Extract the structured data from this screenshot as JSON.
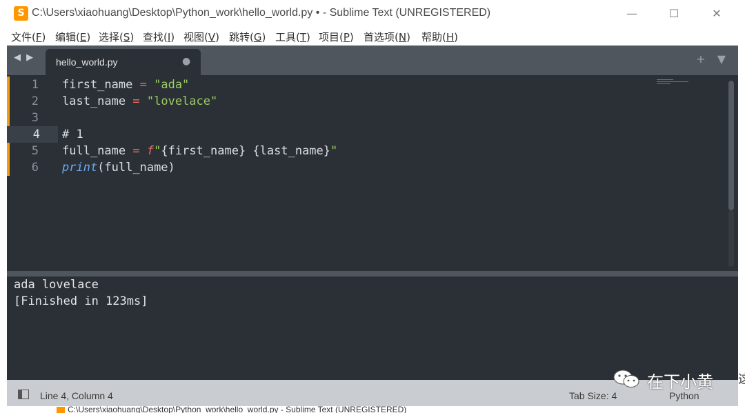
{
  "window": {
    "title": "C:\\Users\\xiaohuang\\Desktop\\Python_work\\hello_world.py • - Sublime Text (UNREGISTERED)",
    "icon": "sublime-logo-icon",
    "app_icon_glyph": "S",
    "minimize": "—",
    "maximize": "☐",
    "close": "✕"
  },
  "menu": [
    {
      "label": "文件(",
      "key": "F",
      "end": ")"
    },
    {
      "label": "编辑(",
      "key": "E",
      "end": ")"
    },
    {
      "label": "选择(",
      "key": "S",
      "end": ")"
    },
    {
      "label": "查找(",
      "key": "I",
      "end": ")"
    },
    {
      "label": "视图(",
      "key": "V",
      "end": ")"
    },
    {
      "label": "跳转(",
      "key": "G",
      "end": ")"
    },
    {
      "label": "工具(",
      "key": "T",
      "end": ")"
    },
    {
      "label": "项目(",
      "key": "P",
      "end": ")"
    },
    {
      "label": "首选项(",
      "key": "N",
      "end": ")"
    },
    {
      "label": "帮助(",
      "key": "H",
      "end": ")"
    }
  ],
  "tabs": {
    "nav": "◀ ▶",
    "active_tab": "hello_world.py",
    "dirty_indicator": "●",
    "right_controls": "+ ▼"
  },
  "editor": {
    "lines": [
      {
        "num": "1"
      },
      {
        "num": "2"
      },
      {
        "num": "3"
      },
      {
        "num": "4"
      },
      {
        "num": "5"
      },
      {
        "num": "6"
      }
    ],
    "code": {
      "l1_var": "first_name",
      "l1_op": "=",
      "l1_str": "\"ada\"",
      "l2_var": "last_name",
      "l2_op": "=",
      "l2_str": "\"lovelace\"",
      "l4_comment": "# 1",
      "l5_var": "full_name",
      "l5_op": "=",
      "l5_prefix": "f",
      "l5_q1": "\"",
      "l5_body": "{first_name} {last_name}",
      "l5_q2": "\"",
      "l6_fn": "print",
      "l6_args": "(full_name)"
    },
    "active_line": 4
  },
  "output": {
    "lines": [
      "ada lovelace",
      "[Finished in 123ms]"
    ]
  },
  "status": {
    "position": "Line 4, Column 4",
    "tab_size": "Tab Size: 4",
    "syntax": "Python"
  },
  "background_window": {
    "title": "C:\\Users\\xiaohuang\\Desktop\\Python_work\\hello_world.py - Sublime Text (UNREGISTERED)"
  },
  "watermark": {
    "text": "在下小黄",
    "icon": "wechat-icon",
    "extra": "这"
  },
  "colors": {
    "editor_bg": "#2b3036",
    "tab_bar": "#50565d",
    "status_bar": "#c9ccd0",
    "modified_marker": "#f39c12",
    "string": "#9ccc65",
    "operator": "#f06c62",
    "builtin": "#6aa8f0"
  }
}
